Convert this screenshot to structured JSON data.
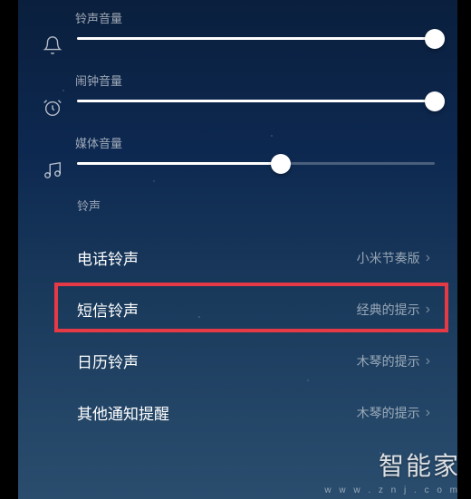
{
  "sliders": {
    "ringtone": {
      "label": "铃声音量",
      "value": 100
    },
    "alarm": {
      "label": "闹钟音量",
      "value": 100
    },
    "media": {
      "label": "媒体音量",
      "value": 57
    }
  },
  "section_header": "铃声",
  "items": {
    "phone_ringtone": {
      "label": "电话铃声",
      "value": "小米节奏版"
    },
    "sms_ringtone": {
      "label": "短信铃声",
      "value": "经典的提示"
    },
    "calendar_ringtone": {
      "label": "日历铃声",
      "value": "木琴的提示"
    },
    "other_ringtone": {
      "label": "其他通知提醒",
      "value": "木琴的提示"
    }
  },
  "watermark": {
    "main": "智能家",
    "sub": "w w w . z n j . c o m"
  }
}
